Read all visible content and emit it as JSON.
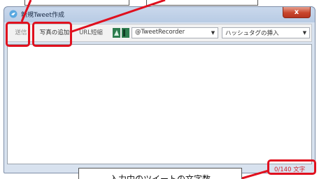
{
  "window": {
    "title": "新規Tweet作成",
    "close_label": "x"
  },
  "toolbar": {
    "send_label": "送信",
    "photo_label": "写真の追加",
    "url_label": "URL短縮",
    "account_value": "@TweetRecorder",
    "hashtag_value": "ハッシュタグの挿入"
  },
  "editor": {
    "value": ""
  },
  "counter": {
    "text": "0/140 文字"
  },
  "annotations": {
    "bottom_callout": "入力中のツイートの文字数"
  },
  "colors": {
    "highlight": "#e0101e",
    "counter_text": "#d4202a",
    "close_button": "#c9462c"
  },
  "icons": {
    "app": "twitter-bird-icon",
    "account": "account-avatar-icon",
    "dropdown": "chevron-down-icon"
  }
}
